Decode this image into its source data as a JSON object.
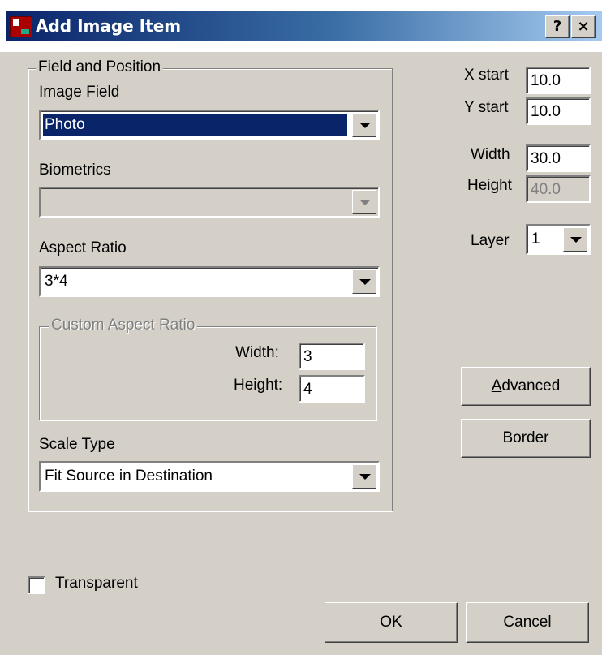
{
  "window": {
    "title": "Add Image Item",
    "help_label": "?",
    "close_label": "×"
  },
  "field_and_position": {
    "legend": "Field and Position",
    "image_field_label": "Image Field",
    "image_field_value": "Photo",
    "biometrics_label": "Biometrics",
    "biometrics_value": "",
    "aspect_ratio_label": "Aspect Ratio",
    "aspect_ratio_value": "3*4",
    "custom_aspect": {
      "legend": "Custom Aspect Ratio",
      "width_label": "Width:",
      "width_value": "3",
      "height_label": "Height:",
      "height_value": "4"
    },
    "scale_type_label": "Scale Type",
    "scale_type_value": "Fit Source in Destination"
  },
  "position": {
    "x_start_label": "X start",
    "x_start_value": "10.0",
    "y_start_label": "Y start",
    "y_start_value": "10.0",
    "width_label": "Width",
    "width_value": "30.0",
    "height_label": "Height",
    "height_value": "40.0",
    "layer_label": "Layer",
    "layer_value": "1"
  },
  "buttons": {
    "advanced_accel": "A",
    "advanced_rest": "dvanced",
    "border": "Border",
    "ok": "OK",
    "cancel": "Cancel"
  },
  "transparent_label": "Transparent",
  "transparent_checked": false,
  "colors": {
    "title_bar_start": "#0a246a",
    "title_bar_end": "#a6caf0",
    "dialog_face": "#d4d0c8",
    "selection": "#0a246a"
  }
}
